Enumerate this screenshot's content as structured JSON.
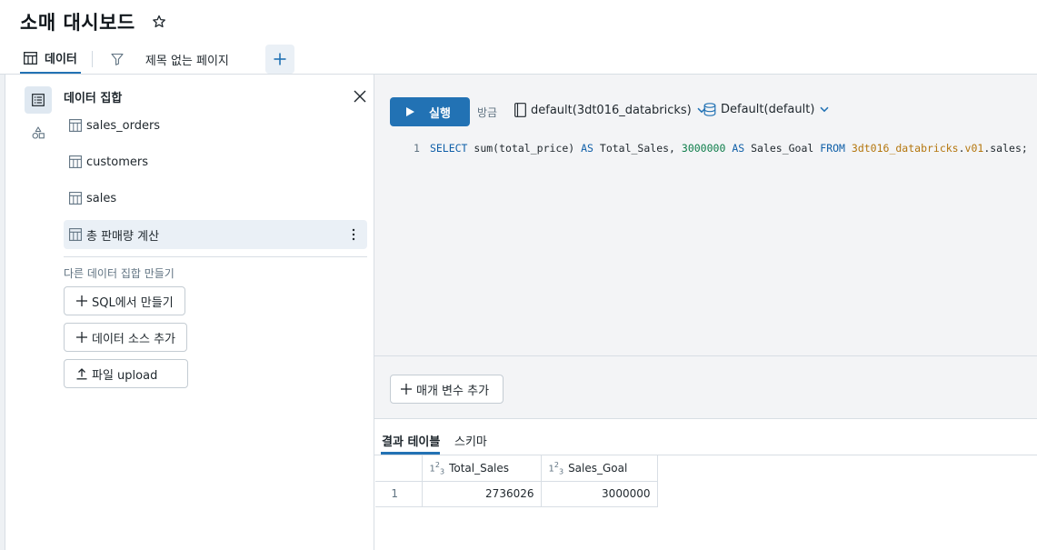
{
  "header": {
    "title": "소매 대시보드"
  },
  "tabs": {
    "data_label": "데이터",
    "page_label": "제목 없는 페이지"
  },
  "panel": {
    "title": "데이터 집합",
    "datasets": [
      {
        "label": "sales_orders"
      },
      {
        "label": "customers"
      },
      {
        "label": "sales"
      },
      {
        "label": "총 판매량 계산"
      }
    ],
    "create_label": "다른 데이터 집합 만들기",
    "buttons": {
      "sql": "SQL에서 만들기",
      "source": "데이터 소스 추가",
      "upload": "파일 upload"
    }
  },
  "editor": {
    "run_label": "실행",
    "run_time": "방금",
    "catalog": "default(3dt016_databricks)",
    "schema": "Default(default)",
    "line_number": "1",
    "code": {
      "select": "SELECT",
      "func": " sum(total_price) ",
      "as1": "AS",
      "alias1": " Total_Sales, ",
      "number": "3000000",
      "as2": "AS",
      "alias2": " Sales_Goal ",
      "from": "FROM",
      "table_a": "3dt016_databricks",
      "dot1": ".",
      "table_b": "v01",
      "dot2": ".sales;"
    },
    "add_param_label": "매개 변수 추가"
  },
  "results": {
    "tabs": [
      "결과 테이블",
      "스키마"
    ],
    "columns": [
      "Total_Sales",
      "Sales_Goal"
    ],
    "rows": [
      {
        "index": "1",
        "values": [
          "2736026",
          "3000000"
        ]
      }
    ]
  },
  "colors": {
    "accent": "#2272b4",
    "keyword": "#0f5fa8",
    "number": "#0d7d4a",
    "table_ref": "#b4760d"
  },
  "icons": [
    "star-icon",
    "table-icon",
    "filter-icon",
    "plus-icon",
    "dataset-list-icon",
    "shapes-icon",
    "close-icon",
    "kebab-icon",
    "play-icon",
    "notebook-icon",
    "database-icon",
    "chevron-down-icon",
    "upload-icon"
  ]
}
